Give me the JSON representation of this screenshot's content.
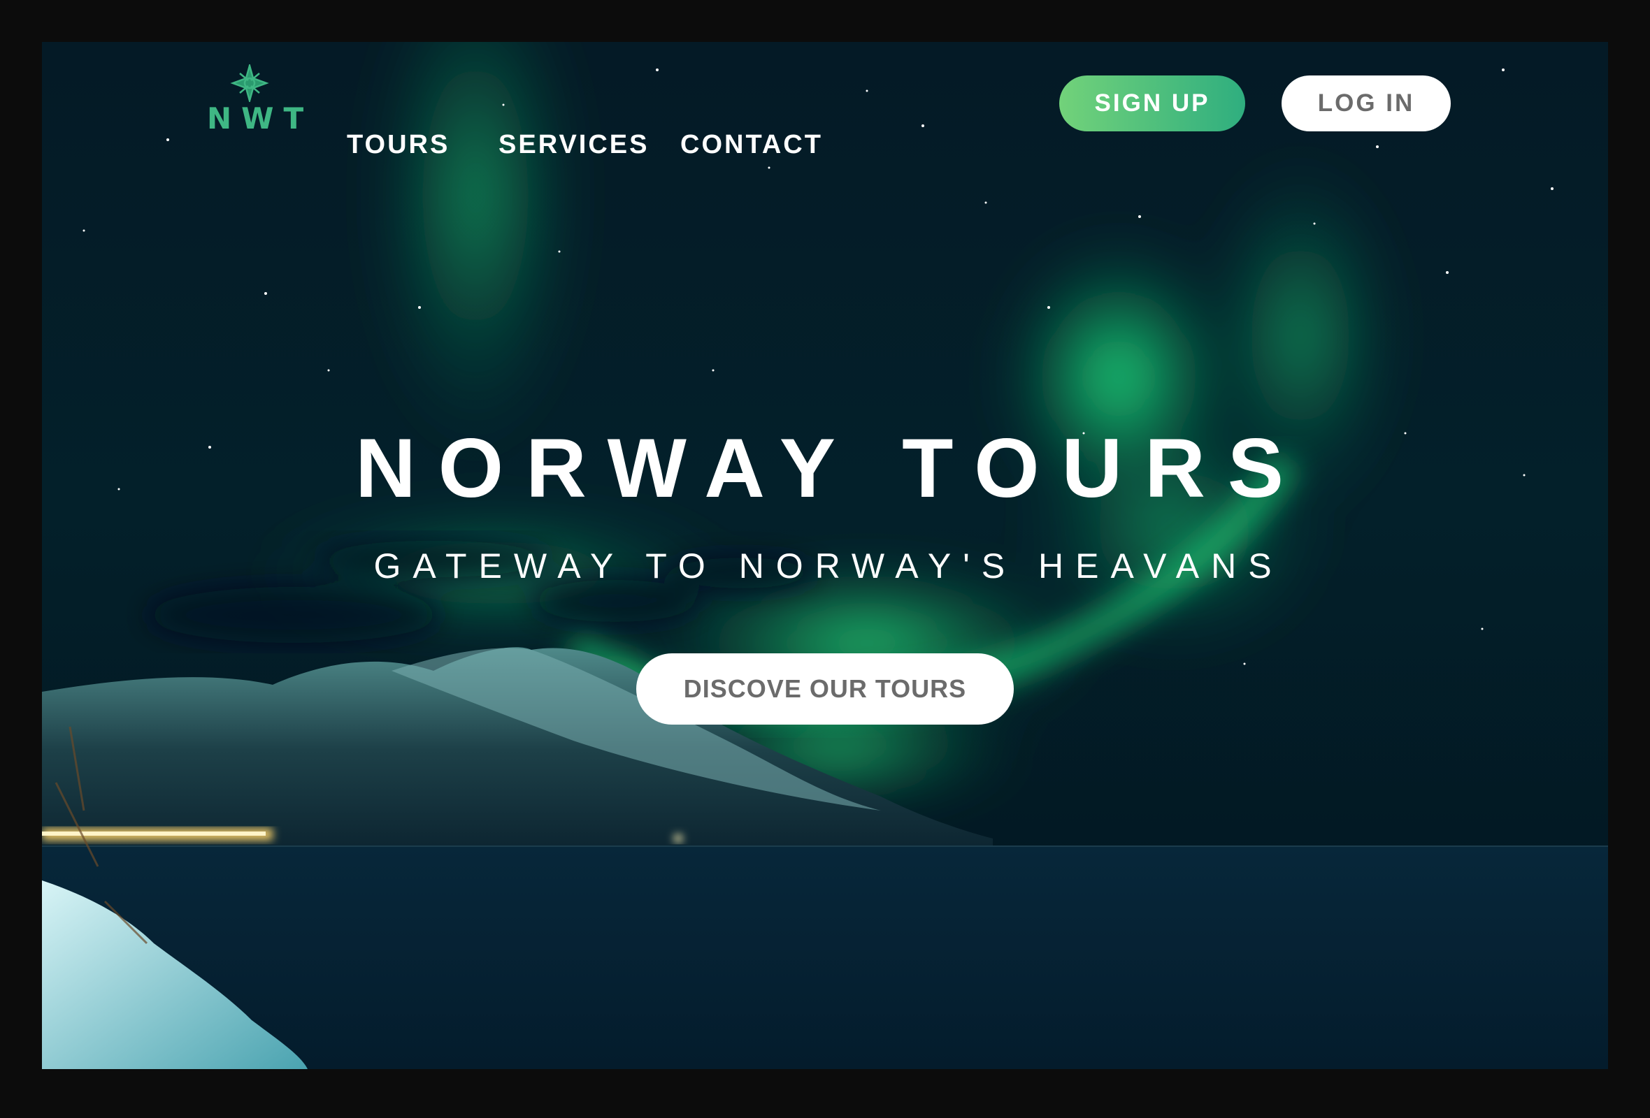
{
  "brand": {
    "logo_text": "NWT",
    "logo_color": "#3fb784"
  },
  "nav": {
    "links": [
      {
        "label": "TOURS"
      },
      {
        "label": "SERVICES"
      },
      {
        "label": "CONTACT"
      }
    ]
  },
  "auth": {
    "signup_label": "SIGN UP",
    "login_label": "LOG IN",
    "signup_gradient": [
      "#72d27a",
      "#2fae7f"
    ]
  },
  "hero": {
    "title": "NORWAY TOURS",
    "subtitle": "GATEWAY TO NORWAY'S HEAVANS",
    "cta_label": "DISCOVE OUR TOURS",
    "background": "northern-lights-over-fjord-photo"
  },
  "colors": {
    "page_background": "#0c0c0c",
    "sky": "#031220",
    "aurora": "#19e07a",
    "button_text": "#6b6b6b"
  }
}
